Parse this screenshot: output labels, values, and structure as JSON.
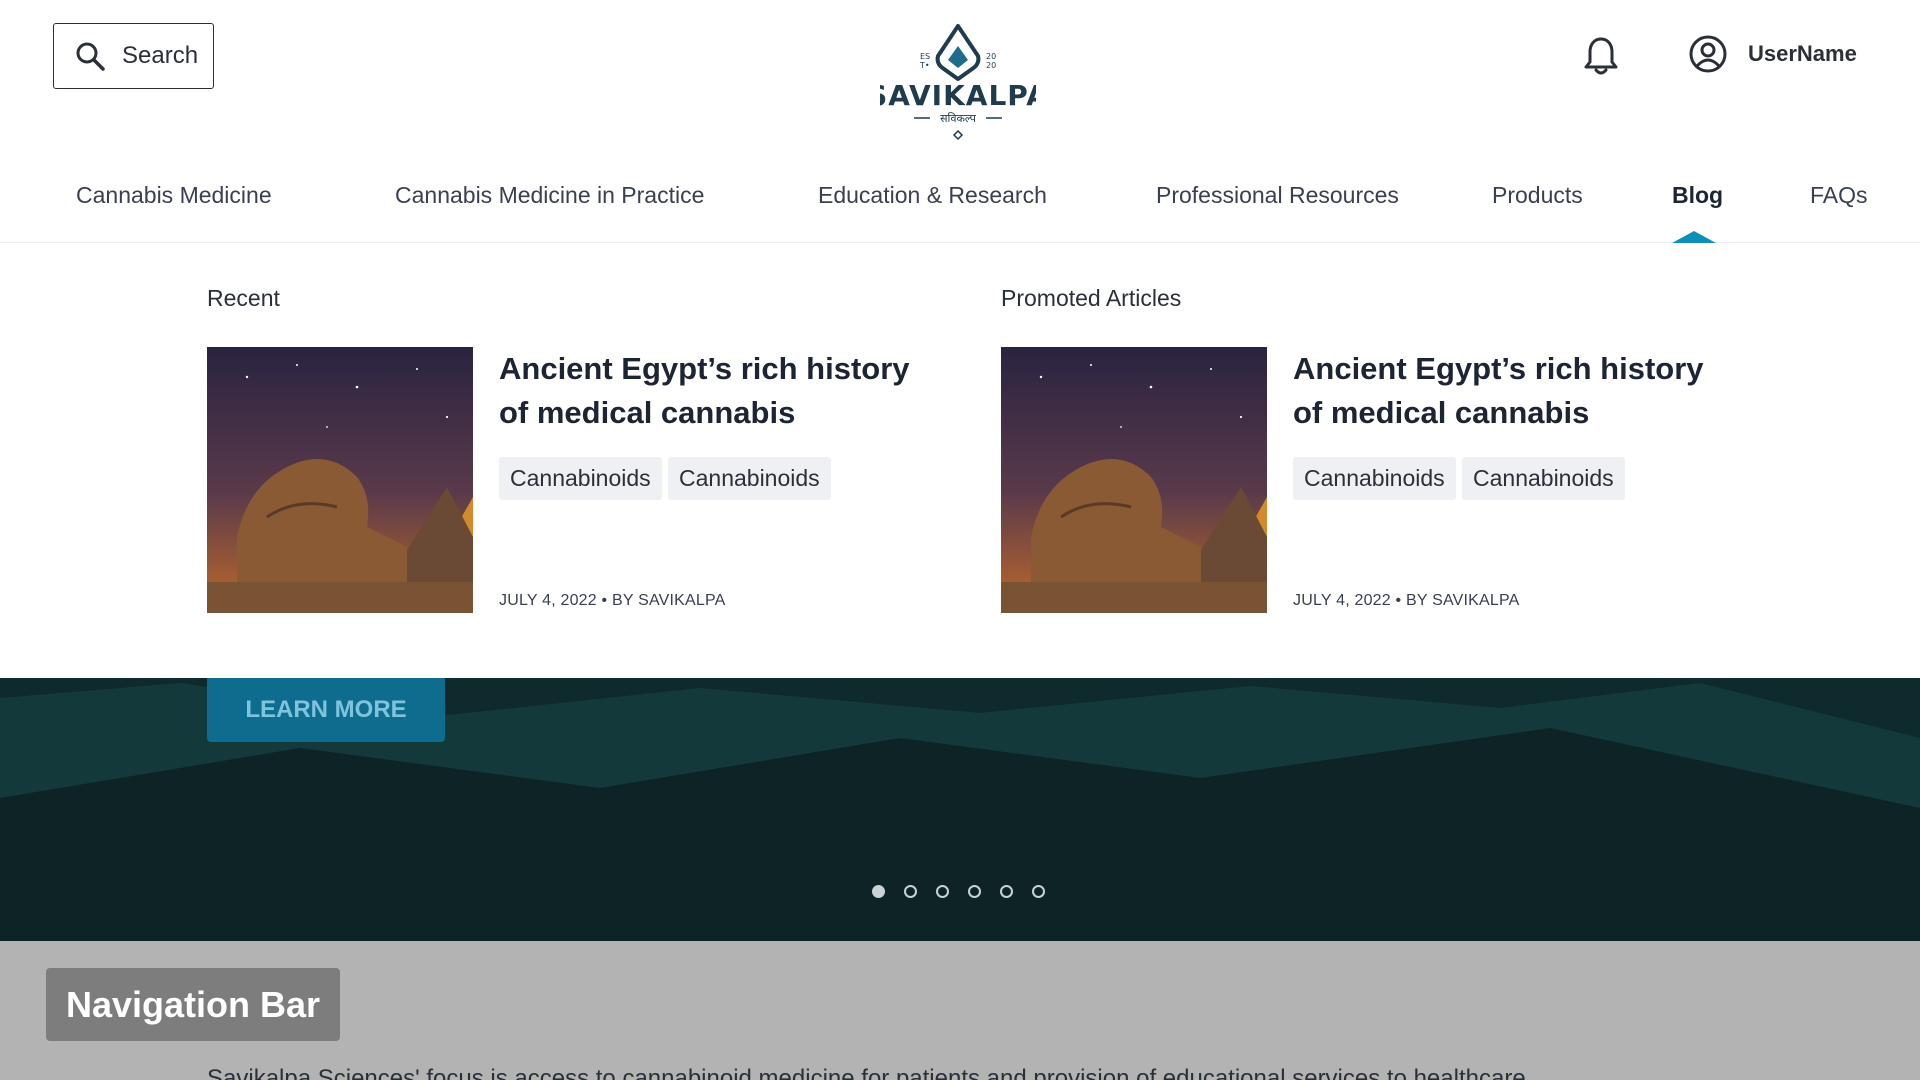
{
  "header": {
    "search_label": "Search",
    "logo": {
      "name": "SAVIKALPA",
      "subtitle": "सविकल्प",
      "est_left_top": "ES",
      "est_left_bottom": "T•",
      "est_right_top": "20",
      "est_right_bottom": "20"
    },
    "username": "UserName"
  },
  "nav": {
    "items": [
      {
        "label": "Cannabis Medicine"
      },
      {
        "label": "Cannabis Medicine in Practice"
      },
      {
        "label": "Education & Research"
      },
      {
        "label": "Professional Resources"
      },
      {
        "label": "Products"
      },
      {
        "label": "Blog",
        "active": true
      },
      {
        "label": "FAQs"
      }
    ]
  },
  "dropdown": {
    "recent": {
      "section_label": "Recent",
      "title": "Ancient Egypt’s rich history of medical cannabis",
      "tags": [
        "Cannabinoids",
        "Cannabinoids"
      ],
      "meta": "JULY 4, 2022 • BY SAVIKALPA"
    },
    "promoted": {
      "section_label": "Promoted Articles",
      "title": "Ancient Egypt’s rich history of medical cannabis",
      "tags": [
        "Cannabinoids",
        "Cannabinoids"
      ],
      "meta": "JULY 4, 2022 • BY SAVIKALPA"
    }
  },
  "hero": {
    "learn_more": "LEARN MORE",
    "carousel_dots": 6,
    "active_dot": 1
  },
  "bottom": {
    "badge": "Navigation Bar",
    "description": "Savikalpa Sciences' focus is access to cannabinoid medicine for patients and provision of educational services to healthcare"
  },
  "colors": {
    "accent": "#0e8fb8",
    "button_bg": "#0e6d8f",
    "hero_bg": "#0f2a2c",
    "logo": "#1f3b4d"
  },
  "icons": [
    "search-icon",
    "bell-icon",
    "user-circle-icon"
  ]
}
